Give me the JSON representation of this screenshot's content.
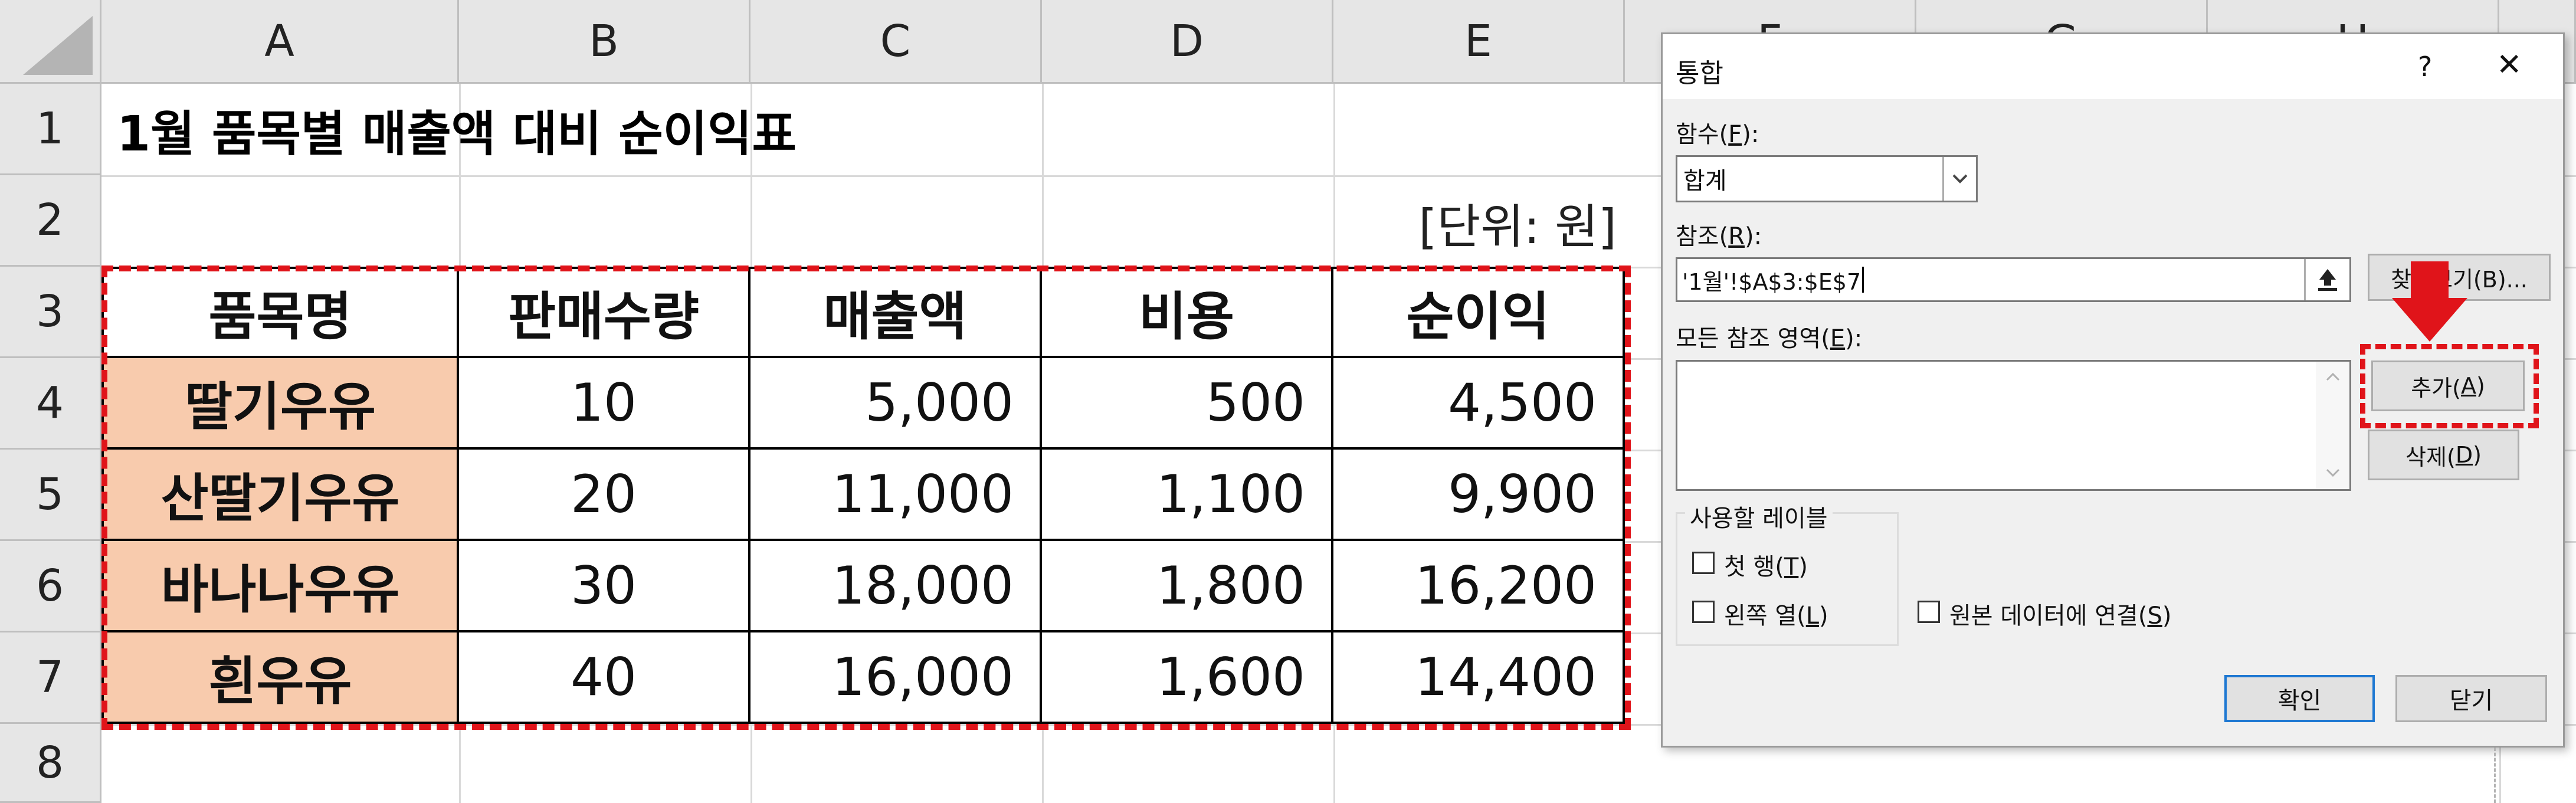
{
  "sheet": {
    "columns": [
      "A",
      "B",
      "C",
      "D",
      "E",
      "F",
      "G",
      "H"
    ],
    "rows": [
      "1",
      "2",
      "3",
      "4",
      "5",
      "6",
      "7",
      "8"
    ],
    "title": "1월 품목별 매출액 대비 순이익표",
    "unit": "[단위: 원]",
    "table": {
      "headers": [
        "품목명",
        "판매수량",
        "매출액",
        "비용",
        "순이익"
      ],
      "rows": [
        {
          "name": "딸기우유",
          "qty": "10",
          "sales": "5,000",
          "cost": "500",
          "profit": "4,500"
        },
        {
          "name": "산딸기우유",
          "qty": "20",
          "sales": "11,000",
          "cost": "1,100",
          "profit": "9,900"
        },
        {
          "name": "바나나우유",
          "qty": "30",
          "sales": "18,000",
          "cost": "1,800",
          "profit": "16,200"
        },
        {
          "name": "흰우유",
          "qty": "40",
          "sales": "16,000",
          "cost": "1,600",
          "profit": "14,400"
        }
      ]
    }
  },
  "dialog": {
    "title": "통합",
    "help": "?",
    "close": "✕",
    "function_label": "함수(",
    "function_key": "F",
    "function_label_end": "):",
    "function_value": "합계",
    "reference_label": "참조(",
    "reference_key": "R",
    "reference_label_end": "):",
    "reference_value": "'1월'!$A$3:$E$7",
    "browse_label": "찾아보기(B)...",
    "all_refs_label": "모든 참조 영역(",
    "all_refs_key": "E",
    "all_refs_label_end": "):",
    "add_label": "추가(",
    "add_key": "A",
    "add_label_end": ")",
    "delete_label": "삭제(",
    "delete_key": "D",
    "delete_label_end": ")",
    "labels_group": "사용할 레이블",
    "top_row_label": "첫 행(",
    "top_row_key": "T",
    "top_row_label_end": ")",
    "left_col_label": "왼쪽 열(",
    "left_col_key": "L",
    "left_col_label_end": ")",
    "link_label": "원본 데이터에 연결(",
    "link_key": "S",
    "link_label_end": ")",
    "ok": "확인",
    "close_button": "닫기"
  },
  "colors": {
    "highlight": "#e0141a",
    "name_cell": "#f8cbad"
  }
}
